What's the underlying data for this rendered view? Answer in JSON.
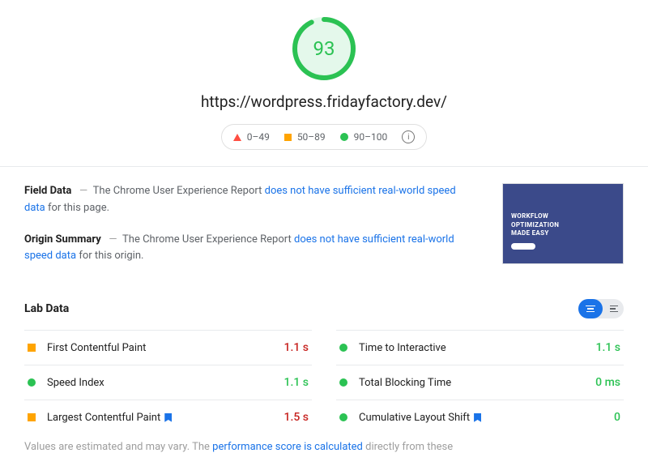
{
  "score": "93",
  "url": "https://wordpress.fridayfactory.dev/",
  "legend": {
    "poor": "0–49",
    "avg": "50–89",
    "good": "90–100"
  },
  "field_data": {
    "label": "Field Data",
    "crux_prefix": "The Chrome User Experience Report ",
    "link": "does not have sufficient real-world speed data",
    "suffix": " for this page."
  },
  "origin_summary": {
    "label": "Origin Summary",
    "crux_prefix": "The Chrome User Experience Report ",
    "link": "does not have sufficient real-world speed data",
    "suffix": " for this origin."
  },
  "thumb": {
    "line1": "WORKFLOW",
    "line2": "OPTIMIZATION",
    "line3": "MADE EASY"
  },
  "lab": {
    "title": "Lab Data",
    "metrics": [
      {
        "name": "First Contentful Paint",
        "value": "1.1 s",
        "status": "orange",
        "bookmark": false
      },
      {
        "name": "Time to Interactive",
        "value": "1.1 s",
        "status": "green",
        "bookmark": false
      },
      {
        "name": "Speed Index",
        "value": "1.1 s",
        "status": "green",
        "bookmark": false
      },
      {
        "name": "Total Blocking Time",
        "value": "0 ms",
        "status": "green",
        "bookmark": false
      },
      {
        "name": "Largest Contentful Paint",
        "value": "1.5 s",
        "status": "orange",
        "bookmark": true
      },
      {
        "name": "Cumulative Layout Shift",
        "value": "0",
        "status": "green",
        "bookmark": true
      }
    ]
  },
  "footer": {
    "prefix": "Values are estimated and may vary. The ",
    "link": "performance score is calculated",
    "suffix": " directly from these"
  }
}
